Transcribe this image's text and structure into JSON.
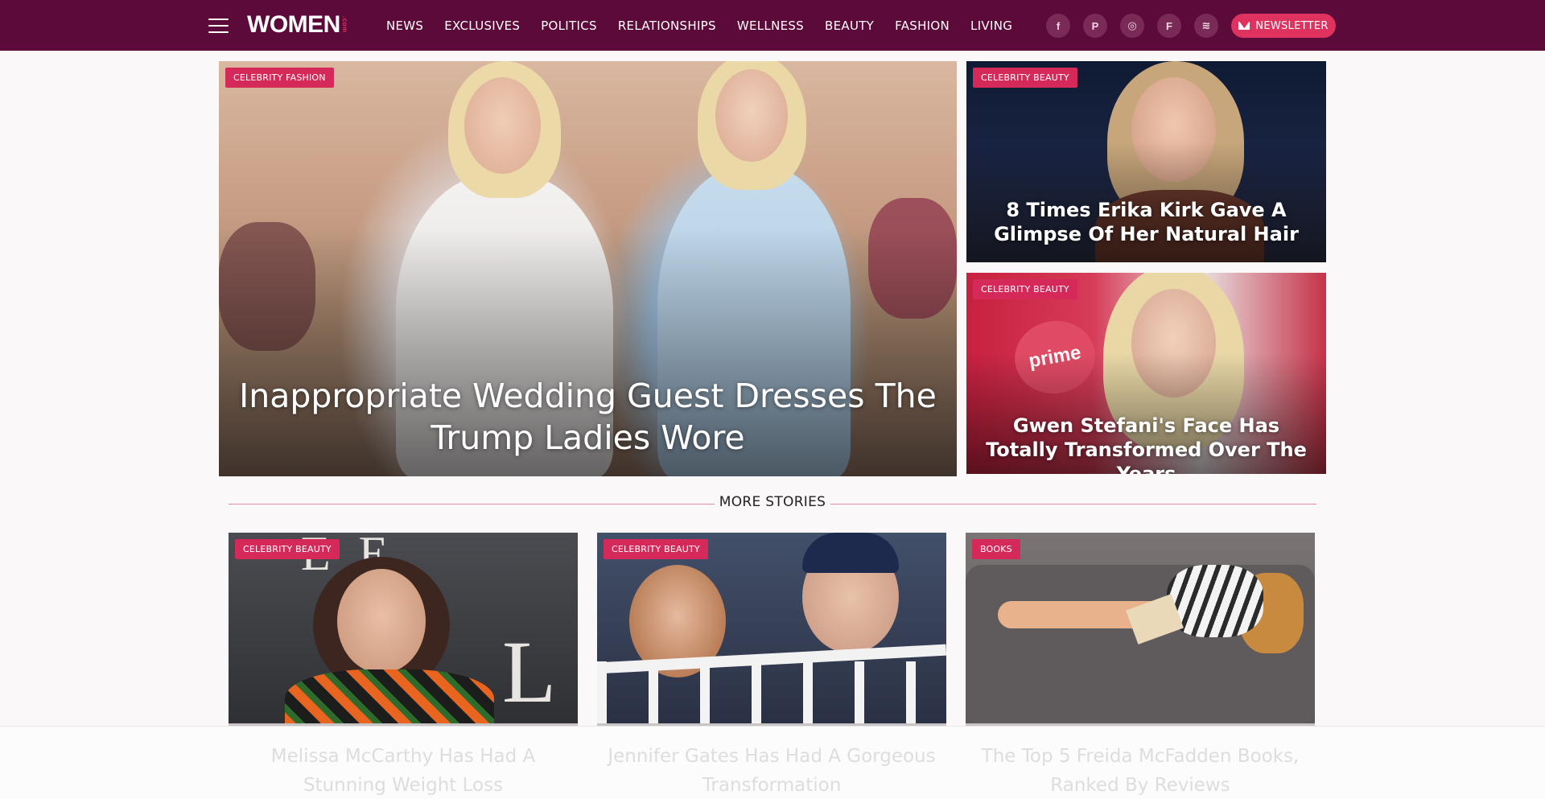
{
  "header": {
    "logo": "WOMEN",
    "logo_sub": ".com",
    "nav": [
      "NEWS",
      "EXCLUSIVES",
      "POLITICS",
      "RELATIONSHIPS",
      "WELLNESS",
      "BEAUTY",
      "FASHION",
      "LIVING"
    ],
    "socials": [
      {
        "icon": "facebook-icon",
        "glyph": "f"
      },
      {
        "icon": "pinterest-icon",
        "glyph": "P"
      },
      {
        "icon": "instagram-icon",
        "glyph": "◎"
      },
      {
        "icon": "flipboard-icon",
        "glyph": "F"
      },
      {
        "icon": "rss-icon",
        "glyph": "≋"
      }
    ],
    "newsletter_label": "NEWSLETTER"
  },
  "hero": {
    "main": {
      "tag": "CELEBRITY FASHION",
      "title": "Inappropriate Wedding Guest Dresses The Trump Ladies Wore"
    },
    "side1": {
      "tag": "CELEBRITY BEAUTY",
      "title": "8 Times Erika Kirk Gave A Glimpse Of Her Natural Hair"
    },
    "side2": {
      "tag": "CELEBRITY BEAUTY",
      "title": "Gwen Stefani's Face Has Totally Transformed Over The Years",
      "sign": "prime"
    }
  },
  "more_stories": {
    "heading": "MORE STORIES",
    "items": [
      {
        "tag": "CELEBRITY BEAUTY",
        "title": "Melissa McCarthy Has Had A Stunning Weight Loss"
      },
      {
        "tag": "CELEBRITY BEAUTY",
        "title": "Jennifer Gates Has Had A Gorgeous Transformation"
      },
      {
        "tag": "BOOKS",
        "title": "The Top 5 Freida McFadden Books, Ranked By Reviews"
      }
    ]
  },
  "colors": {
    "header_bg": "#5c0a3a",
    "accent": "#e0325f",
    "tag_bg": "#d5295a"
  }
}
